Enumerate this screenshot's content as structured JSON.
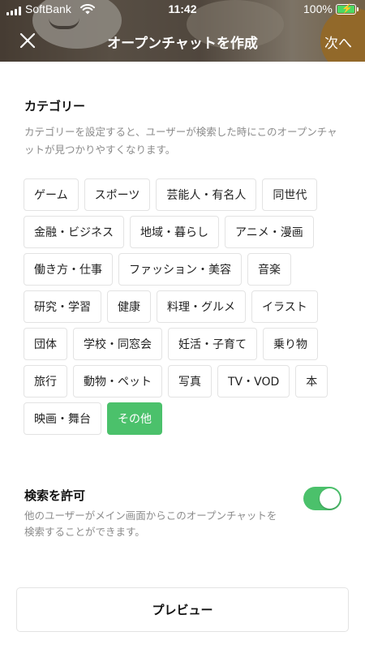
{
  "status_bar": {
    "carrier": "SoftBank",
    "time": "11:42",
    "battery": "100%",
    "icons": [
      "signal-icon",
      "wifi-icon",
      "battery-charging-icon"
    ]
  },
  "nav": {
    "title": "オープンチャットを作成",
    "next_label": "次へ",
    "close_icon": "close-icon"
  },
  "category": {
    "title": "カテゴリー",
    "description": "カテゴリーを設定すると、ユーザーが検索した時にこのオープンチャットが見つかりやすくなります。",
    "rows": [
      [
        "ゲーム",
        "スポーツ",
        "芸能人・有名人",
        "同世代"
      ],
      [
        "金融・ビジネス",
        "地域・暮らし",
        "アニメ・漫画"
      ],
      [
        "働き方・仕事",
        "ファッション・美容",
        "音楽"
      ],
      [
        "研究・学習",
        "健康",
        "料理・グルメ",
        "イラスト"
      ],
      [
        "団体",
        "学校・同窓会",
        "妊活・子育て",
        "乗り物"
      ],
      [
        "旅行",
        "動物・ペット",
        "写真",
        "TV・VOD",
        "本"
      ],
      [
        "映画・舞台",
        "その他"
      ]
    ],
    "selected": "その他",
    "selected_color": "#4bc16b"
  },
  "search": {
    "title": "検索を許可",
    "description": "他のユーザーがメイン画面からこのオープンチャットを検索することができます。",
    "enabled": true
  },
  "preview": {
    "label": "プレビュー"
  }
}
